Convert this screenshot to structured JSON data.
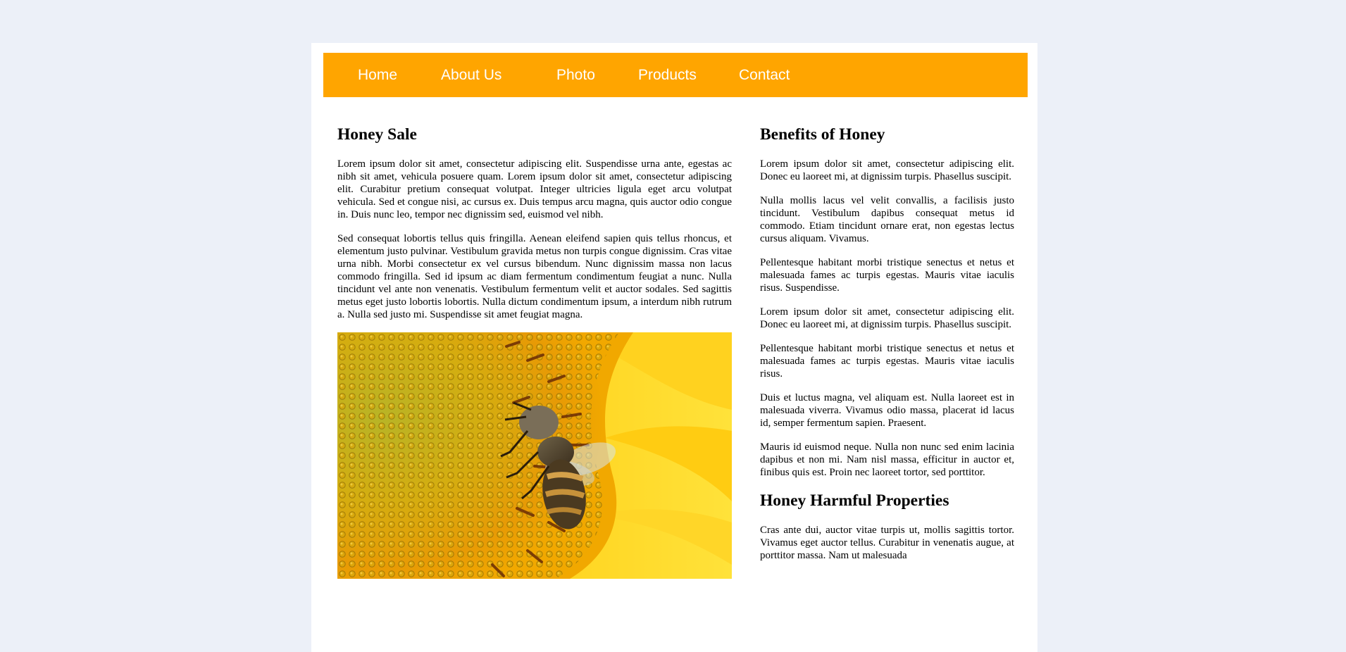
{
  "nav": {
    "items": [
      "Home",
      "About Us",
      "Photo",
      "Products",
      "Contact"
    ]
  },
  "main": {
    "title": "Honey Sale",
    "paragraphs": [
      "Lorem ipsum dolor sit amet, consectetur adipiscing elit. Suspendisse urna ante, egestas ac nibh sit amet, vehicula posuere quam. Lorem ipsum dolor sit amet, consectetur adipiscing elit. Curabitur pretium consequat volutpat. Integer ultricies ligula eget arcu volutpat vehicula. Sed et congue nisi, ac cursus ex. Duis tempus arcu magna, quis auctor odio congue in. Duis nunc leo, tempor nec dignissim sed, euismod vel nibh.",
      "Sed consequat lobortis tellus quis fringilla. Aenean eleifend sapien quis tellus rhoncus, et elementum justo pulvinar. Vestibulum gravida metus non turpis congue dignissim. Cras vitae urna nibh. Morbi consectetur ex vel cursus bibendum. Nunc dignissim massa non lacus commodo fringilla. Sed id ipsum ac diam fermentum condimentum feugiat a nunc. Nulla tincidunt vel ante non venenatis. Vestibulum fermentum velit et auctor sodales. Sed sagittis metus eget justo lobortis lobortis. Nulla dictum condimentum ipsum, a interdum nibh rutrum a. Nulla sed justo mi. Suspendisse sit amet feugiat magna."
    ]
  },
  "side": {
    "benefits_title": "Benefits of Honey",
    "benefits": [
      "Lorem ipsum dolor sit amet, consectetur adipiscing elit. Donec eu laoreet mi, at dignissim turpis. Phasellus suscipit.",
      "Nulla mollis lacus vel velit convallis, a facilisis justo tincidunt. Vestibulum dapibus consequat metus id commodo. Etiam tincidunt ornare erat, non egestas lectus cursus aliquam. Vivamus.",
      "Pellentesque habitant morbi tristique senectus et netus et malesuada fames ac turpis egestas. Mauris vitae iaculis risus. Suspendisse.",
      "Lorem ipsum dolor sit amet, consectetur adipiscing elit. Donec eu laoreet mi, at dignissim turpis. Phasellus suscipit.",
      "Pellentesque habitant morbi tristique senectus et netus et malesuada fames ac turpis egestas. Mauris vitae iaculis risus.",
      "Duis et luctus magna, vel aliquam est. Nulla laoreet est in malesuada viverra. Vivamus odio massa, placerat id lacus id, semper fermentum sapien. Praesent.",
      "Mauris id euismod neque. Nulla non nunc sed enim lacinia dapibus et non mi. Nam nisl massa, efficitur in auctor et, finibus quis est. Proin nec laoreet tortor, sed porttitor."
    ],
    "harmful_title": "Honey Harmful Properties",
    "harmful": [
      "Cras ante dui, auctor vitae turpis ut, mollis sagittis tortor. Vivamus eget auctor tellus. Curabitur in venenatis augue, at porttitor massa. Nam ut malesuada"
    ]
  },
  "colors": {
    "nav_background": "#ffa500",
    "nav_text": "#ffffff",
    "page_background": "#ecf0f8",
    "content_background": "#ffffff"
  }
}
